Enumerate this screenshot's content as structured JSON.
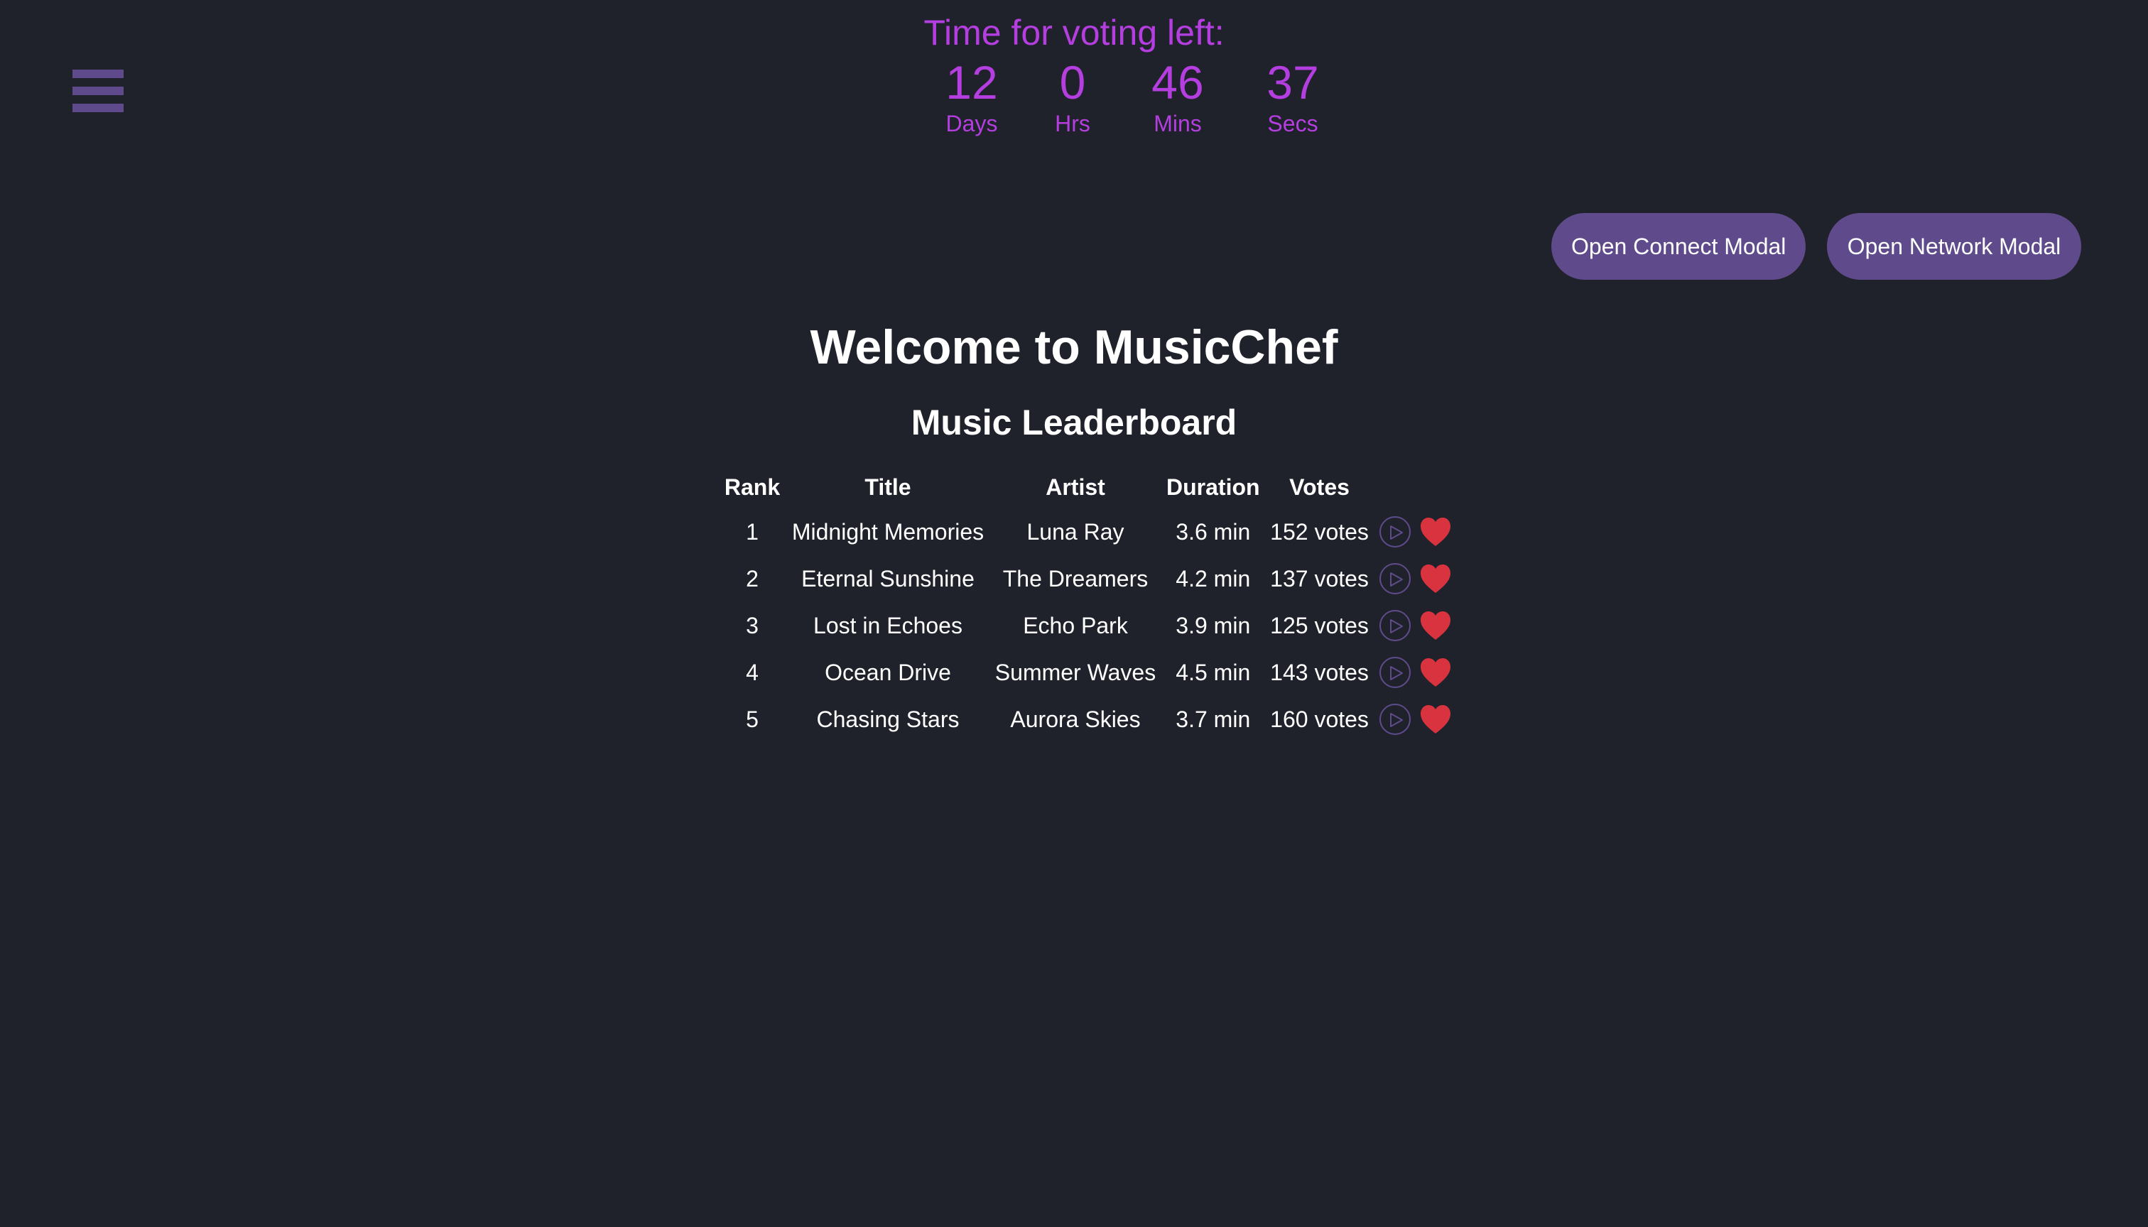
{
  "menu": {
    "icon": "hamburger-menu-icon"
  },
  "countdown": {
    "heading": "Time for voting left:",
    "units": [
      {
        "value": "12",
        "label": "Days"
      },
      {
        "value": "0",
        "label": "Hrs"
      },
      {
        "value": "46",
        "label": "Mins"
      },
      {
        "value": "37",
        "label": "Secs"
      }
    ],
    "color": "#b43ee0"
  },
  "buttons": {
    "connect_label": "Open Connect Modal",
    "network_label": "Open Network Modal",
    "color": "#5f4b8b"
  },
  "page_title": "Welcome to MusicChef",
  "section_title": "Music Leaderboard",
  "leaderboard": {
    "headers": {
      "rank": "Rank",
      "title": "Title",
      "artist": "Artist",
      "duration": "Duration",
      "votes": "Votes"
    },
    "rows": [
      {
        "rank": "1",
        "title": "Midnight Memories",
        "artist": "Luna Ray",
        "duration": "3.6 min",
        "votes": "152 votes"
      },
      {
        "rank": "2",
        "title": "Eternal Sunshine",
        "artist": "The Dreamers",
        "duration": "4.2 min",
        "votes": "137 votes"
      },
      {
        "rank": "3",
        "title": "Lost in Echoes",
        "artist": "Echo Park",
        "duration": "3.9 min",
        "votes": "125 votes"
      },
      {
        "rank": "4",
        "title": "Ocean Drive",
        "artist": "Summer Waves",
        "duration": "4.5 min",
        "votes": "143 votes"
      },
      {
        "rank": "5",
        "title": "Chasing Stars",
        "artist": "Aurora Skies",
        "duration": "3.7 min",
        "votes": "160 votes"
      }
    ],
    "row_icons": {
      "play": "play-icon",
      "like": "heart-icon"
    },
    "heart_color": "#d9333f"
  },
  "colors": {
    "background": "#20222b",
    "accent": "#5f4b8b",
    "text": "#ffffff"
  }
}
